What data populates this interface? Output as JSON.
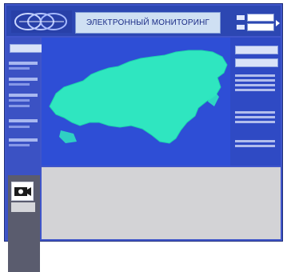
{
  "header": {
    "title": "ЭЛЕКТРОННЫЙ МОНИТОРИНГ"
  },
  "colors": {
    "background": "#3f55c9",
    "header": "#2c47b2",
    "title_bar": "#cfe0f3",
    "map_land": "#2fe6c0",
    "map_water": "#2e4ed6",
    "content": "#d3d3d6",
    "sidebar_gray": "#5a5c6e"
  },
  "icons": {
    "logo": "logo-icon",
    "camera": "camera-icon",
    "go": "arrow-right-icon"
  }
}
